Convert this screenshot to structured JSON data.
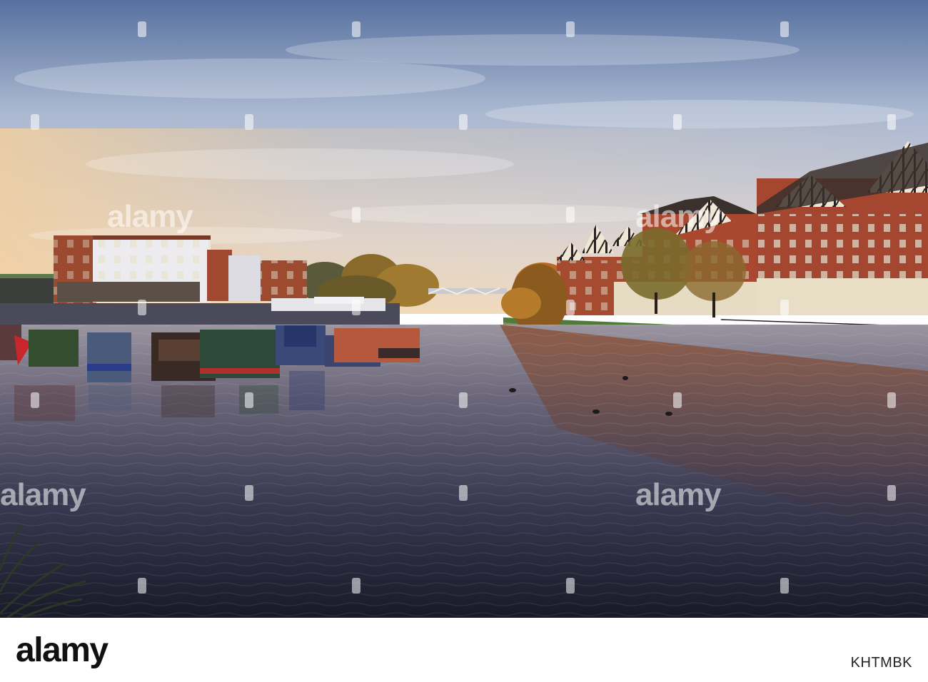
{
  "photo": {
    "subject": "marina",
    "sky_top": "#5d75a6",
    "sky_mid": "#b9c3d6",
    "sky_horizon": "#f0d6b8",
    "water_top": "#8e8a95",
    "water_dark": "#1d1e2f",
    "brick": "#a2432c",
    "foliage": "#b9772a"
  },
  "watermark": {
    "text": "alamy",
    "marks": [
      "marker",
      "marker",
      "marker",
      "marker"
    ]
  },
  "footer": {
    "logo": "alamy",
    "image_id": "KHTMBK"
  }
}
